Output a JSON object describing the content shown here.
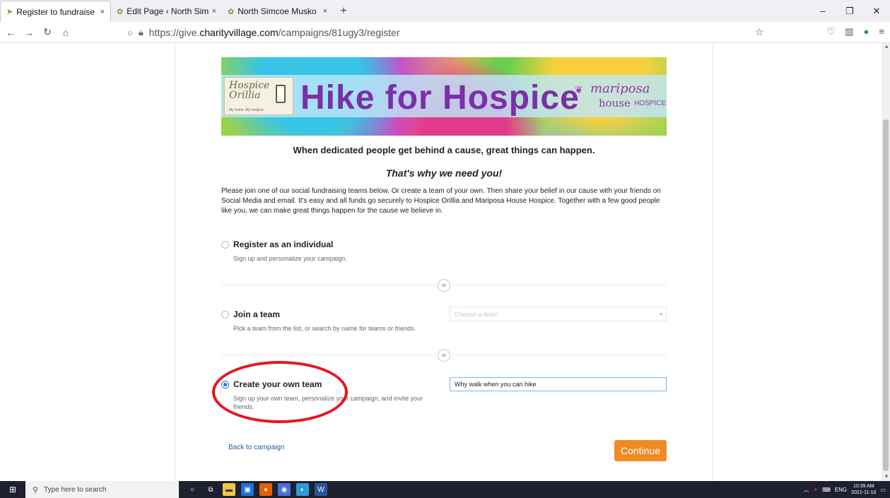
{
  "browser": {
    "tabs": [
      {
        "title": "Register to fundraise",
        "active": true
      },
      {
        "title": "Edit Page ‹ North Sim",
        "active": false
      },
      {
        "title": "North Simcoe Musko",
        "active": false
      }
    ],
    "new_tab_symbol": "+",
    "url_prefix": "https://give.",
    "url_domain": "charityvillage.com",
    "url_path": "/campaigns/81ugy3/register"
  },
  "banner": {
    "title": "Hike for Hospice",
    "left_logo_line1": "Hospice",
    "left_logo_line2": "Orillia",
    "left_logo_tag": "My home. My hospice.",
    "right_logo_name": "mariposa",
    "right_logo_house": "house",
    "right_logo_hospice": "HOSPICE"
  },
  "content": {
    "tagline": "When dedicated people get behind a cause, great things can happen.",
    "why": "That's why we need you!",
    "intro": "Please join one of our social fundraising teams below. Or create a team of your own. Then share your belief in our cause with your friends on Social Media and email. It's easy and all funds go securely to Hospice Orillia and Mariposa House Hospice. Together with a few good people like you, we can make great things happen for the cause we believe in.",
    "or_label": "or",
    "options": [
      {
        "label": "Register as an individual",
        "desc": "Sign up and personalize your campaign.",
        "selected": false
      },
      {
        "label": "Join a team",
        "desc": "Pick a team from the list, or search by name for teams or friends.",
        "selected": false
      },
      {
        "label": "Create your own team",
        "desc": "Sign up your own team, personalize your campaign, and invite your friends.",
        "selected": true
      }
    ],
    "team_select_placeholder": "Choose a team",
    "team_name_value": "Why walk when you can hike",
    "back_link": "Back to campaign",
    "continue_label": "Continue"
  },
  "taskbar": {
    "search_placeholder": "Type here to search",
    "lang": "ENG",
    "time": "10:39 AM",
    "date": "2021-11-10"
  },
  "colors": {
    "accent_orange": "#f08a24",
    "link_blue": "#1f5c9e",
    "radio_blue": "#1a73d9",
    "highlight_red": "#e3171d",
    "title_purple": "#7b2fa8"
  }
}
